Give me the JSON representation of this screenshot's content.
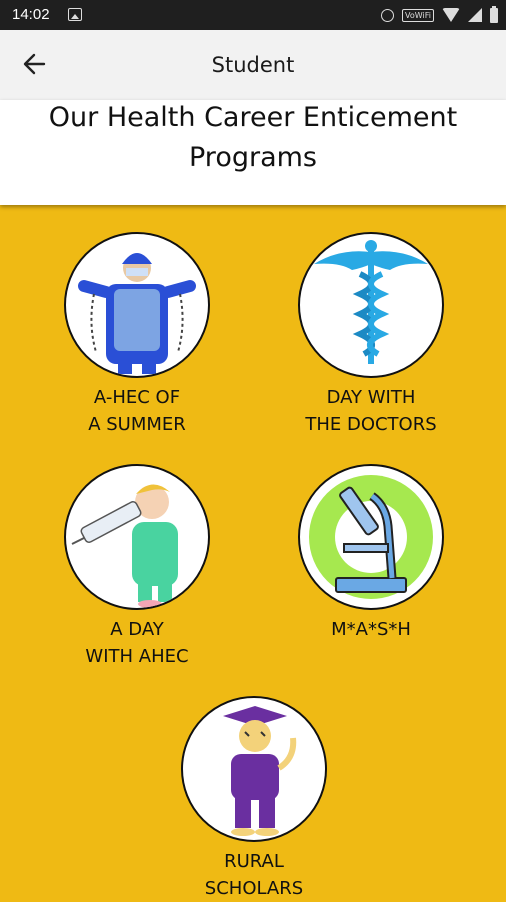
{
  "status_bar": {
    "time": "14:02",
    "network_label": "VoWiFi"
  },
  "app_bar": {
    "title": "Student"
  },
  "header": {
    "title": "Our Health Career Enticement Programs"
  },
  "programs": [
    {
      "label": "A-HEC OF\nA SUMMER",
      "icon": "surgeon-icon"
    },
    {
      "label": "DAY WITH\nTHE DOCTORS",
      "icon": "caduceus-icon"
    },
    {
      "label": "A DAY\nWITH AHEC",
      "icon": "nurse-syringe-icon"
    },
    {
      "label": "M*A*S*H",
      "icon": "microscope-icon"
    },
    {
      "label": "RURAL\nSCHOLARS",
      "icon": "tiger-graduate-icon"
    }
  ],
  "colors": {
    "background": "#efba14",
    "app_bar": "#f2f2f2",
    "status_bar": "#1f1f1f"
  }
}
